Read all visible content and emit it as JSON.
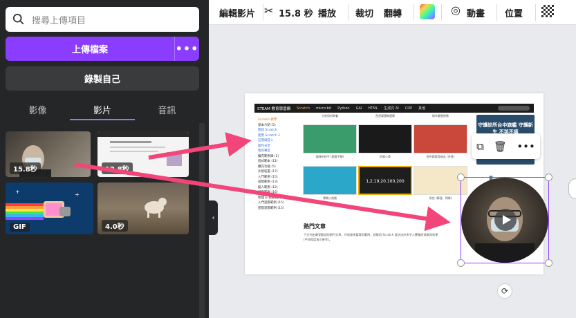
{
  "left_panel": {
    "search_placeholder": "搜尋上傳項目",
    "upload_label": "上傳檔案",
    "upload_more": "•••",
    "record_label": "錄製自己",
    "tabs": [
      {
        "label": "影像"
      },
      {
        "label": "影片"
      },
      {
        "label": "音訊"
      }
    ],
    "active_tab": "影片",
    "thumbnails": [
      {
        "badge": "15.8秒"
      },
      {
        "badge": "12.8秒"
      },
      {
        "badge": "GIF"
      },
      {
        "badge": "4.0秒"
      }
    ]
  },
  "toolbar": {
    "edit_video": "編輯影片",
    "trim_time": "15.8 秒",
    "play": "播放",
    "crop": "裁切",
    "flip": "翻轉",
    "animate": "動畫",
    "position": "位置"
  },
  "canvas": {
    "site_brand": "STEAM 教育學習網",
    "site_nav": [
      "Scratch",
      "micro:bit",
      "Python",
      "GAI",
      "HTML",
      "生成式 AI",
      "CDP",
      "其他"
    ],
    "sidebar_heading": "Scratch 教學",
    "sidebar_items": [
      "基本介紹 (5)",
      "開啟 Scratch",
      "使用 Scratch 3",
      "註冊與登入",
      "操作分享",
      "我的專案",
      "擴充範例庫 (2)",
      "程式範本 (11)",
      "擴充功能 (5)",
      "外接裝置 (17)",
      "入門範例 (15)",
      "進階範例 (13)",
      "擬人範例 (12)",
      "極限範例 (16)",
      "物理 & 模擬範例 (12)",
      "入門遊戲範例 (15)",
      "進階遊戲範例 (15)"
    ],
    "grid_captions": [
      "貓咪拍拍手 (跟著手腳)",
      "搭乘火車",
      "角色跟著滑鼠走 (多邊)",
      "彈跳小遊戲",
      "1,2,19,20,100,200",
      "角色 (轉速、閃爍)"
    ],
    "grid_labels": [
      "大使用的飼養",
      "刮刮樂隨機選擇",
      "操作鍵盤移動"
    ],
    "hot_title": "熱門文章",
    "hot_desc": "下方列出最受歡迎的熱門文章，共收錄多篇實用範例，就能用 Scratch 設計出許多令人驚豔的遊戲與效果 (不同程度皆可參考)。",
    "promo_text": "守護診所台中旗艦 守護新生 不哭不痛",
    "promo_label": "雷:"
  },
  "context_menu": {
    "copy_icon": "copy-icon",
    "delete_icon": "trash-icon",
    "more": "•••"
  },
  "colors": {
    "panel_bg": "#252627",
    "accent": "#8b3dff",
    "canvas_bg": "#e8eaed"
  }
}
